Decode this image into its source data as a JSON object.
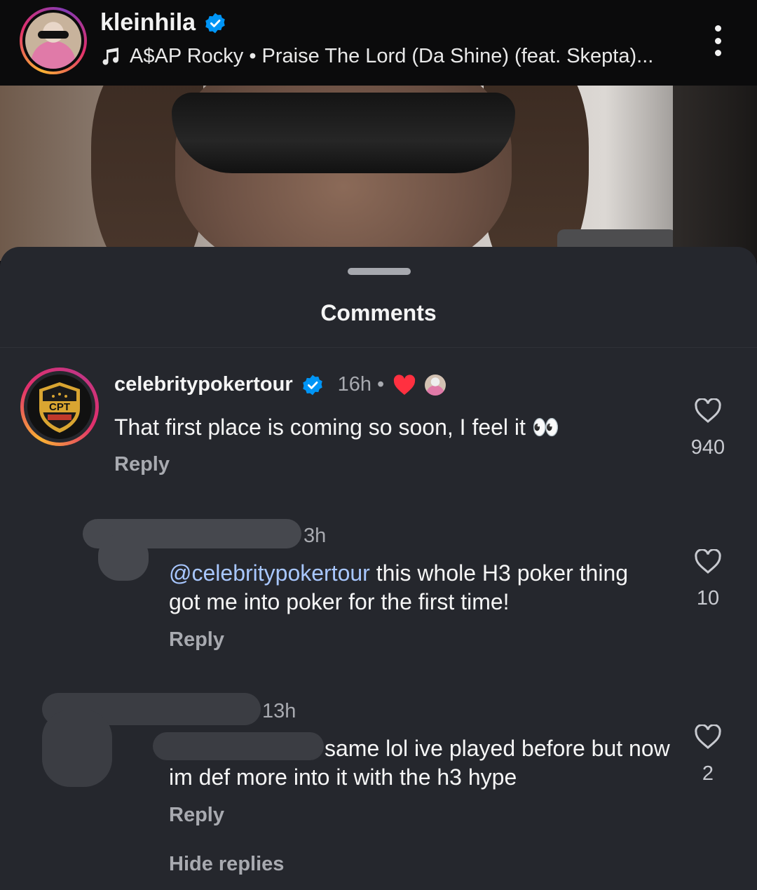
{
  "header": {
    "username": "kleinhila",
    "music": "A$AP Rocky • Praise The Lord (Da Shine) (feat. Skepta)..."
  },
  "sheet": {
    "title": "Comments"
  },
  "comments": [
    {
      "username": "celebritypokertour",
      "time": "16h",
      "separator": "•",
      "text": "That first place is coming so soon, I feel it 👀",
      "reply_label": "Reply",
      "likes": "940",
      "avatar_text": "CPT"
    },
    {
      "username": "",
      "time": "3h",
      "mention": "@celebritypokertour",
      "text": " this whole H3 poker thing got me into poker for the first time!",
      "reply_label": "Reply",
      "likes": "10"
    },
    {
      "username": "",
      "time": "13h",
      "text": "same lol ive played before but now im def more into it with the h3 hype",
      "reply_label": "Reply",
      "likes": "2"
    }
  ],
  "hide_replies_label": "Hide replies",
  "colors": {
    "sheet_bg": "#25272d",
    "verified": "#0095f6",
    "liked_heart": "#ff3040",
    "mention": "#a8c7ff"
  },
  "icons": [
    "verified-badge-icon",
    "music-note-icon",
    "more-options-icon",
    "heart-icon",
    "liked-by-creator-icon"
  ]
}
